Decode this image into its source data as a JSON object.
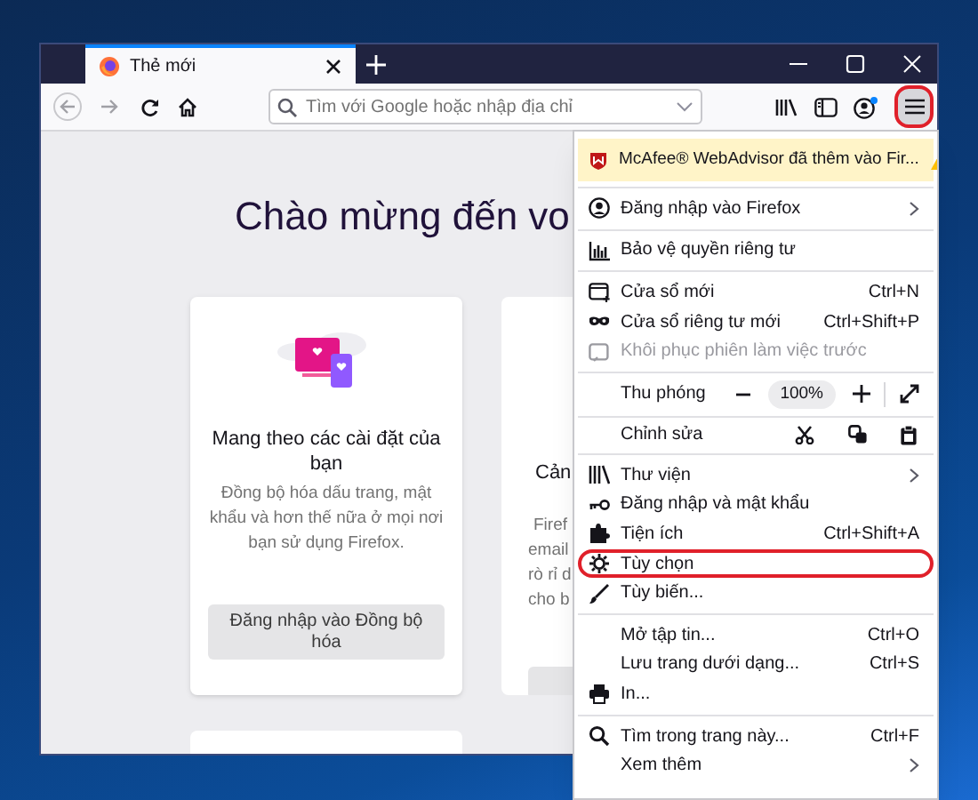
{
  "tab": {
    "title": "Thẻ mới",
    "selected": true
  },
  "address_bar": {
    "placeholder": "Tìm với Google hoặc nhập địa chỉ"
  },
  "menu_button": {
    "highlighted": true
  },
  "welcome": {
    "heading": "Chào mừng đến vo",
    "cards": [
      {
        "title": "Mang theo các cài đặt của bạn",
        "description": "Đồng bộ hóa dấu trang, mật khẩu và hơn thế nữa ở mọi nơi bạn sử dụng Firefox.",
        "button": "Đăng nhập vào Đồng bộ hóa"
      },
      {
        "title": "Cản",
        "description_lines": [
          "Firef",
          "email",
          "rò rỉ d",
          "cho b"
        ]
      }
    ]
  },
  "menu": {
    "notice": {
      "text": "McAfee® WebAdvisor đã thêm vào Fir...",
      "warning": true
    },
    "sections": [
      [
        {
          "kind": "item",
          "label": "Đăng nhập vào Firefox",
          "submenu": true,
          "disabled": false,
          "highlighted": false
        }
      ],
      [
        {
          "kind": "item",
          "label": "Bảo vệ quyền riêng tư",
          "submenu": false,
          "disabled": false,
          "highlighted": false
        }
      ],
      [
        {
          "kind": "item",
          "label": "Cửa sổ mới",
          "shortcut": "Ctrl+N",
          "submenu": false,
          "disabled": false,
          "highlighted": false
        },
        {
          "kind": "item",
          "label": "Cửa sổ riêng tư mới",
          "shortcut": "Ctrl+Shift+P",
          "submenu": false,
          "disabled": false,
          "highlighted": false
        },
        {
          "kind": "item",
          "label": "Khôi phục phiên làm việc trước",
          "submenu": false,
          "disabled": true,
          "highlighted": false
        }
      ],
      [
        {
          "kind": "zoom",
          "label": "Thu phóng",
          "value": "100%"
        }
      ],
      [
        {
          "kind": "edit",
          "label": "Chỉnh sửa"
        }
      ],
      [
        {
          "kind": "item",
          "label": "Thư viện",
          "submenu": true,
          "disabled": false,
          "highlighted": false
        },
        {
          "kind": "item",
          "label": "Đăng nhập và mật khẩu",
          "submenu": false,
          "disabled": false,
          "highlighted": false
        },
        {
          "kind": "item",
          "label": "Tiện ích",
          "shortcut": "Ctrl+Shift+A",
          "submenu": false,
          "disabled": false,
          "highlighted": false
        },
        {
          "kind": "item",
          "label": "Tùy chọn",
          "submenu": false,
          "disabled": false,
          "highlighted": true
        },
        {
          "kind": "item",
          "label": "Tùy biến...",
          "submenu": false,
          "disabled": false,
          "highlighted": false
        }
      ],
      [
        {
          "kind": "item",
          "label": "Mở tập tin...",
          "shortcut": "Ctrl+O",
          "submenu": false,
          "disabled": false,
          "highlighted": false
        },
        {
          "kind": "item",
          "label": "Lưu trang dưới dạng...",
          "shortcut": "Ctrl+S",
          "submenu": false,
          "disabled": false,
          "highlighted": false
        },
        {
          "kind": "item",
          "label": "In...",
          "submenu": false,
          "disabled": false,
          "highlighted": false
        }
      ],
      [
        {
          "kind": "item",
          "label": "Tìm trong trang này...",
          "shortcut": "Ctrl+F",
          "submenu": false,
          "disabled": false,
          "highlighted": false
        },
        {
          "kind": "item",
          "label": "Xem thêm",
          "submenu": true,
          "disabled": false,
          "highlighted": false
        }
      ]
    ]
  }
}
